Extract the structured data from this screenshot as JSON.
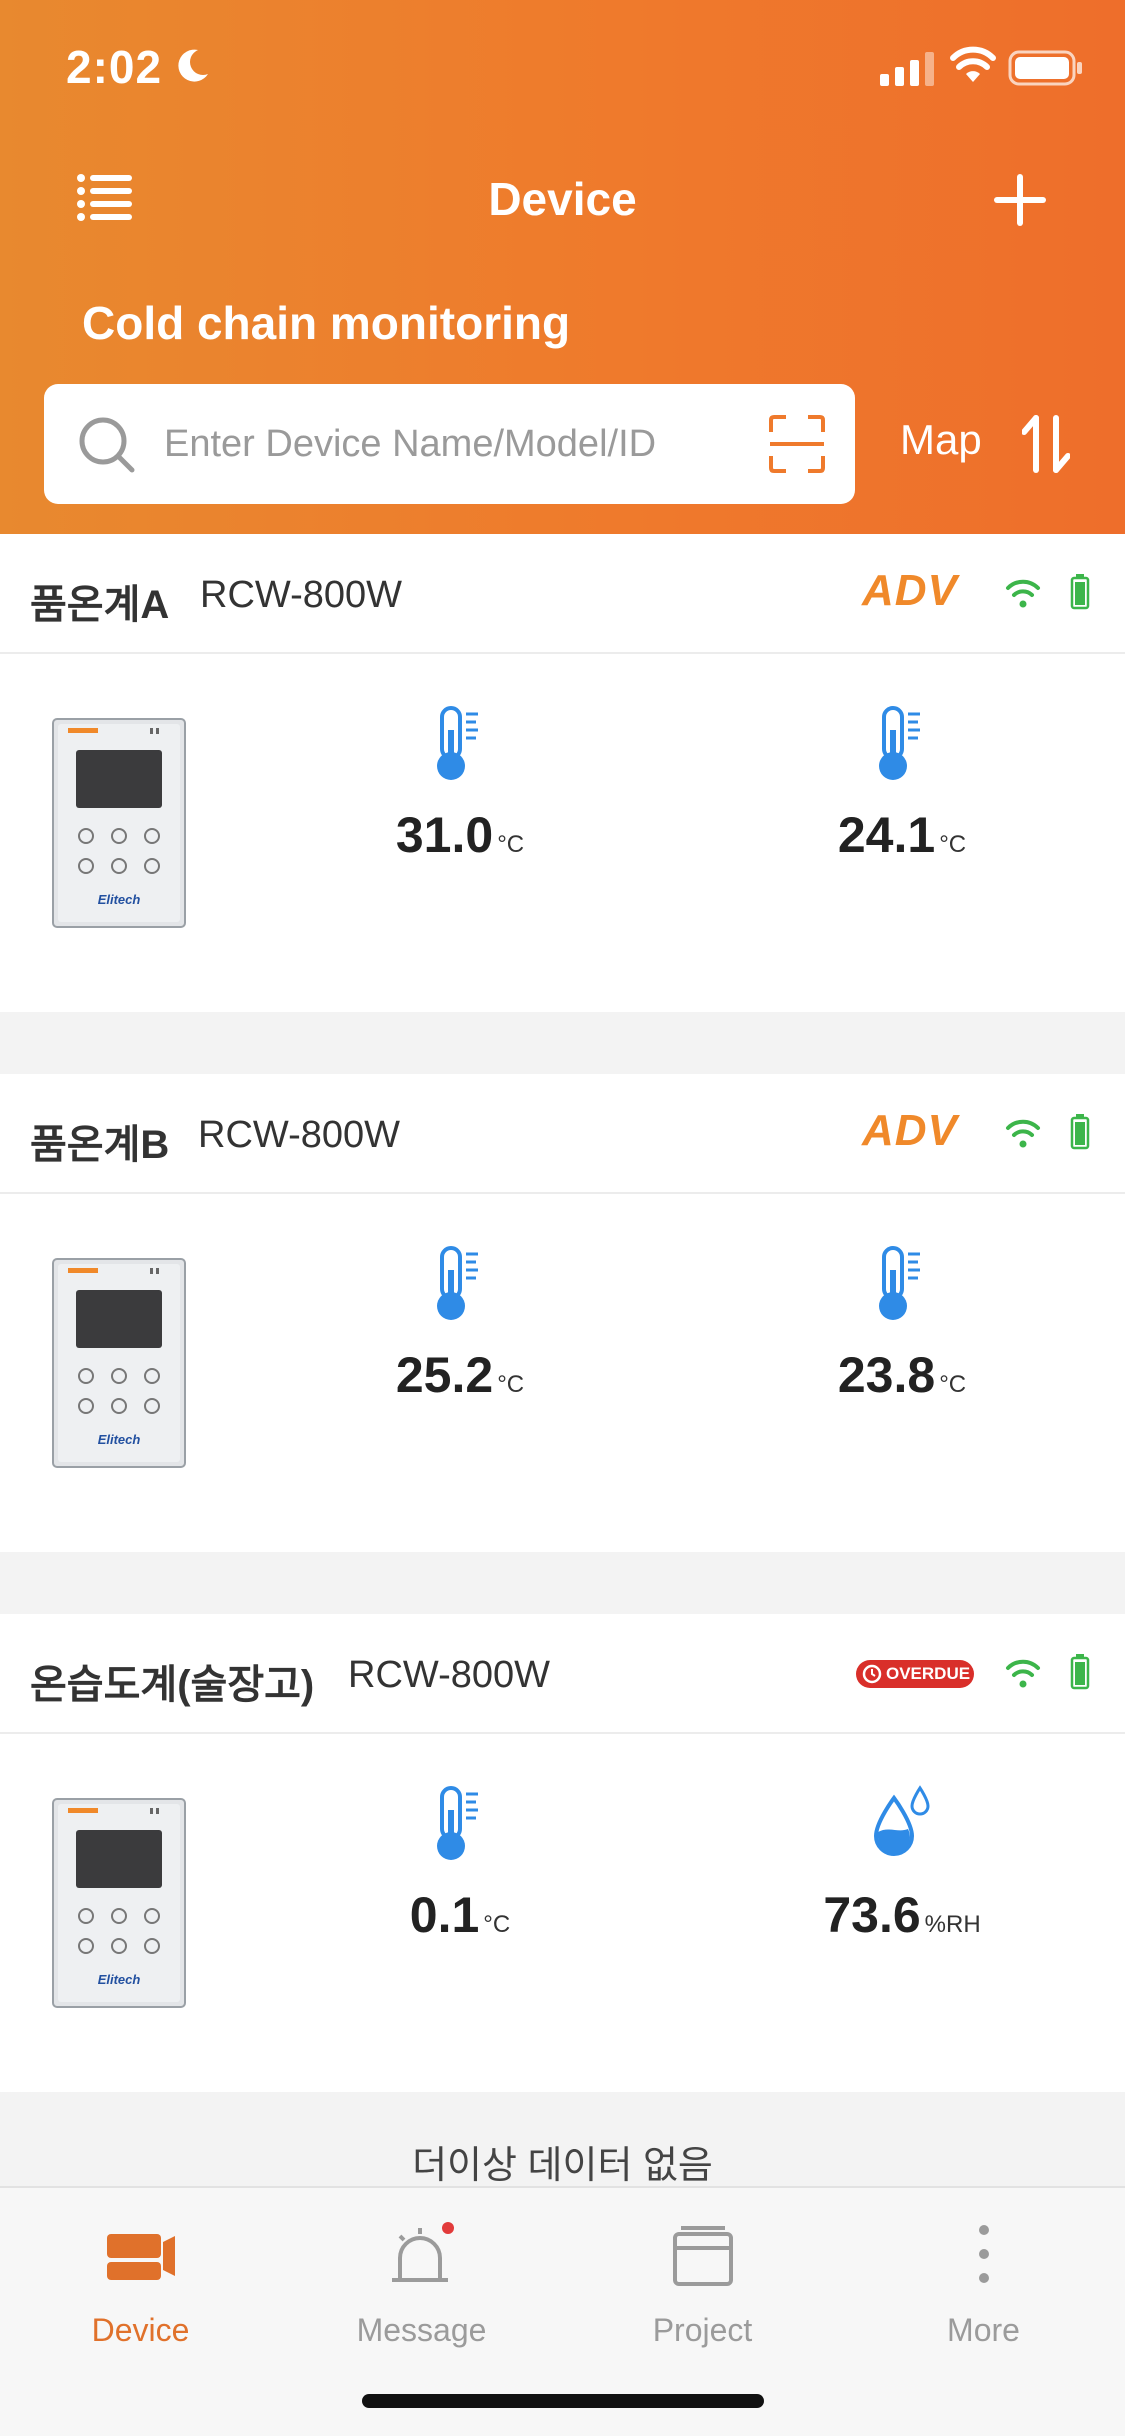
{
  "status_bar": {
    "time": "2:02"
  },
  "nav": {
    "title": "Device"
  },
  "section_title": "Cold chain monitoring",
  "search": {
    "placeholder": "Enter Device Name/Model/ID",
    "value": ""
  },
  "map_label": "Map",
  "colors": {
    "accent": "#ef7a2c",
    "online": "#3cb54a",
    "overdue": "#d92f2a",
    "icon_blue": "#2f8be6"
  },
  "devices": [
    {
      "name": "품온계A",
      "model": "RCW-800W",
      "badge": "ADV",
      "readings": [
        {
          "icon": "thermometer-icon",
          "value": "31.0",
          "unit": "°C"
        },
        {
          "icon": "thermometer-icon",
          "value": "24.1",
          "unit": "°C"
        }
      ]
    },
    {
      "name": "품온계B",
      "model": "RCW-800W",
      "badge": "ADV",
      "readings": [
        {
          "icon": "thermometer-icon",
          "value": "25.2",
          "unit": "°C"
        },
        {
          "icon": "thermometer-icon",
          "value": "23.8",
          "unit": "°C"
        }
      ]
    },
    {
      "name": "온습도계(술장고)",
      "model": "RCW-800W",
      "badge": "OVERDUE",
      "readings": [
        {
          "icon": "thermometer-icon",
          "value": "0.1",
          "unit": "°C"
        },
        {
          "icon": "humidity-drop-icon",
          "value": "73.6",
          "unit": "%RH"
        }
      ]
    }
  ],
  "device_image_brand": "Elitech",
  "no_more_data": "더이상 데이터 없음",
  "tabs": [
    {
      "label": "Device",
      "icon": "device-tab-icon",
      "active": true
    },
    {
      "label": "Message",
      "icon": "bell-icon",
      "active": false
    },
    {
      "label": "Project",
      "icon": "project-icon",
      "active": false
    },
    {
      "label": "More",
      "icon": "more-dots-icon",
      "active": false
    }
  ]
}
